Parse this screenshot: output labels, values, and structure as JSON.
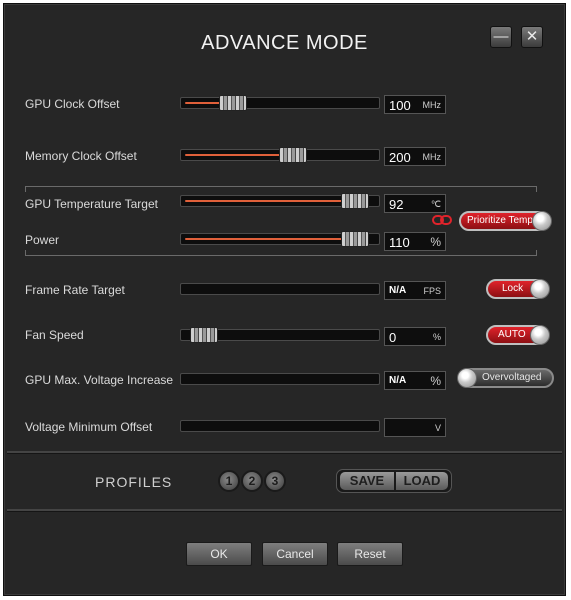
{
  "window": {
    "title": "ADVANCE MODE",
    "minimize_glyph": "—",
    "close_glyph": "✕"
  },
  "settings": {
    "gpu_clock_offset": {
      "label": "GPU Clock Offset",
      "value": "100",
      "unit": "MHz",
      "slider_fraction": 0.22
    },
    "memory_clock_offset": {
      "label": "Memory Clock Offset",
      "value": "200",
      "unit": "MHz",
      "slider_fraction": 0.57
    },
    "gpu_temperature_target": {
      "label": "GPU Temperature Target",
      "value": "92",
      "unit": "℃",
      "slider_fraction": 0.93
    },
    "power": {
      "label": "Power",
      "value": "110",
      "unit": "%",
      "slider_fraction": 0.93
    },
    "frame_rate_target": {
      "label": "Frame Rate Target",
      "value": "N/A",
      "unit": "FPS",
      "toggle_label": "Lock"
    },
    "fan_speed": {
      "label": "Fan Speed",
      "value": "0",
      "unit": "%",
      "slider_fraction": 0.05,
      "toggle_label": "AUTO"
    },
    "gpu_max_voltage_increase": {
      "label": "GPU Max. Voltage Increase",
      "value": "N/A",
      "unit": "%",
      "toggle_label": "Overvoltaged"
    },
    "voltage_minimum_offset": {
      "label": "Voltage Minimum Offset",
      "value": "",
      "unit": "V"
    }
  },
  "prioritize_temp_label": "Prioritize Temp.",
  "profiles": {
    "label": "PROFILES",
    "slots": [
      "1",
      "2",
      "3"
    ],
    "save_label": "SAVE",
    "load_label": "LOAD"
  },
  "buttons": {
    "ok": "OK",
    "cancel": "Cancel",
    "reset": "Reset"
  },
  "colors": {
    "accent": "#e0603a",
    "toggle_red": "#d01e24",
    "background": "#262626"
  }
}
